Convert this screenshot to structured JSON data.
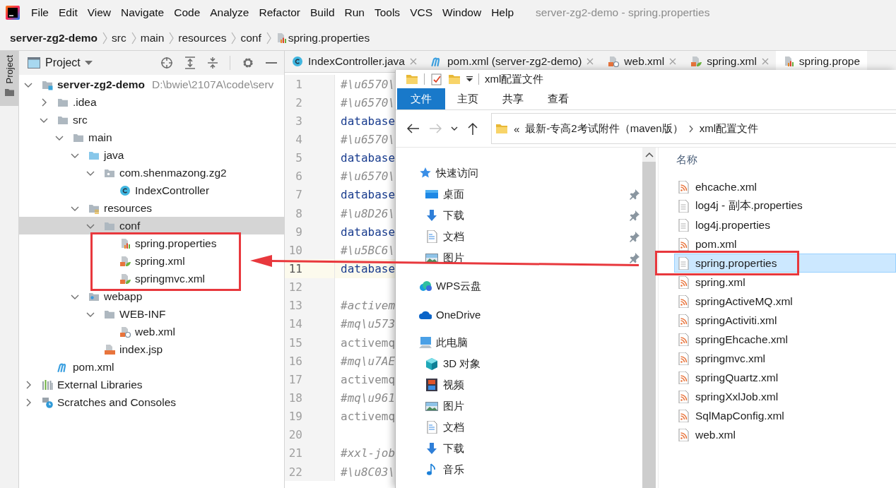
{
  "menu_bar": {
    "items": [
      "File",
      "Edit",
      "View",
      "Navigate",
      "Code",
      "Analyze",
      "Refactor",
      "Build",
      "Run",
      "Tools",
      "VCS",
      "Window",
      "Help"
    ],
    "window_title": "server-zg2-demo - spring.properties"
  },
  "breadcrumb": [
    {
      "label": "server-zg2-demo",
      "kind": "project"
    },
    {
      "label": "src",
      "kind": "folder"
    },
    {
      "label": "main",
      "kind": "folder"
    },
    {
      "label": "resources",
      "kind": "folder"
    },
    {
      "label": "conf",
      "kind": "folder"
    },
    {
      "label": "spring.properties",
      "kind": "properties"
    }
  ],
  "tool_stripe": {
    "label": "Project",
    "selected": true
  },
  "project_panel": {
    "title": "Project",
    "tree": [
      {
        "label": "server-zg2-demo",
        "kind": "module",
        "path": "D:\\bwie\\2107A\\code\\serv",
        "expanded": true,
        "selected": false,
        "children": [
          {
            "label": ".idea",
            "kind": "folder",
            "expanded": false,
            "selected": false
          },
          {
            "label": "src",
            "kind": "folder",
            "expanded": true,
            "selected": false,
            "children": [
              {
                "label": "main",
                "kind": "folder",
                "expanded": true,
                "selected": false,
                "children": [
                  {
                    "label": "java",
                    "kind": "source",
                    "expanded": true,
                    "selected": false,
                    "children": [
                      {
                        "label": "com.shenmazong.zg2",
                        "kind": "package",
                        "expanded": true,
                        "selected": false,
                        "children": [
                          {
                            "label": "IndexController",
                            "kind": "class",
                            "selected": false
                          }
                        ]
                      }
                    ]
                  },
                  {
                    "label": "resources",
                    "kind": "resources",
                    "expanded": true,
                    "selected": false,
                    "children": [
                      {
                        "label": "conf",
                        "kind": "folder",
                        "expanded": true,
                        "selected": true,
                        "children": [
                          {
                            "label": "spring.properties",
                            "kind": "properties",
                            "selected": false
                          },
                          {
                            "label": "spring.xml",
                            "kind": "spring-xml",
                            "selected": false
                          },
                          {
                            "label": "springmvc.xml",
                            "kind": "spring-xml",
                            "selected": false
                          }
                        ]
                      }
                    ]
                  },
                  {
                    "label": "webapp",
                    "kind": "webapp",
                    "expanded": true,
                    "selected": false,
                    "children": [
                      {
                        "label": "WEB-INF",
                        "kind": "folder",
                        "expanded": true,
                        "selected": false,
                        "children": [
                          {
                            "label": "web.xml",
                            "kind": "web-xml",
                            "selected": false
                          }
                        ]
                      },
                      {
                        "label": "index.jsp",
                        "kind": "jsp",
                        "selected": false
                      }
                    ]
                  }
                ]
              }
            ]
          },
          {
            "label": "pom.xml",
            "kind": "maven",
            "selected": false
          }
        ]
      },
      {
        "label": "External Libraries",
        "kind": "libraries",
        "expanded": false,
        "selected": false
      },
      {
        "label": "Scratches and Consoles",
        "kind": "scratches",
        "expanded": false,
        "selected": false
      }
    ]
  },
  "editor": {
    "tabs": [
      {
        "label": "IndexController.java",
        "kind": "class",
        "selected": false,
        "closable": true
      },
      {
        "label": "pom.xml (server-zg2-demo)",
        "kind": "maven",
        "selected": false,
        "closable": true
      },
      {
        "label": "web.xml",
        "kind": "web-xml",
        "selected": false,
        "closable": true
      },
      {
        "label": "spring.xml",
        "kind": "spring-xml",
        "selected": false,
        "closable": true
      },
      {
        "label": "spring.prope",
        "kind": "properties",
        "selected": true,
        "closable": false
      }
    ],
    "lines": [
      {
        "number": "1",
        "text": "#\\u6570\\",
        "kind": "comment",
        "current": false
      },
      {
        "number": "2",
        "text": "#\\u6570\\",
        "kind": "comment",
        "current": false
      },
      {
        "number": "3",
        "text": "database",
        "kind": "key",
        "current": false
      },
      {
        "number": "4",
        "text": "#\\u6570\\",
        "kind": "comment",
        "current": false
      },
      {
        "number": "5",
        "text": "database",
        "kind": "key",
        "current": false
      },
      {
        "number": "6",
        "text": "#\\u6570\\",
        "kind": "comment",
        "current": false
      },
      {
        "number": "7",
        "text": "database",
        "kind": "key",
        "current": false
      },
      {
        "number": "8",
        "text": "#\\u8D26\\",
        "kind": "comment",
        "current": false
      },
      {
        "number": "9",
        "text": "database",
        "kind": "key",
        "current": false
      },
      {
        "number": "10",
        "text": "#\\u5BC6\\",
        "kind": "comment",
        "current": false
      },
      {
        "number": "11",
        "text": "database",
        "kind": "key",
        "current": true
      },
      {
        "number": "12",
        "kind": "blank",
        "current": false
      },
      {
        "number": "13",
        "text": "#activem",
        "kind": "comment",
        "current": false
      },
      {
        "number": "14",
        "text": "#mq\\u573",
        "kind": "comment",
        "current": false
      },
      {
        "number": "15",
        "text": "activemq",
        "kind": "inactive",
        "current": false
      },
      {
        "number": "16",
        "text": "#mq\\u7AE",
        "kind": "comment",
        "current": false
      },
      {
        "number": "17",
        "text": "activemq",
        "kind": "inactive",
        "current": false
      },
      {
        "number": "18",
        "text": "#mq\\u961",
        "kind": "comment",
        "current": false
      },
      {
        "number": "19",
        "text": "activemq",
        "kind": "inactive",
        "current": false
      },
      {
        "number": "20",
        "kind": "blank",
        "current": false
      },
      {
        "number": "21",
        "text": "#xxl-job",
        "kind": "comment",
        "current": false
      },
      {
        "number": "22",
        "text": "#\\u8C03\\",
        "kind": "comment",
        "current": false
      }
    ]
  },
  "explorer": {
    "title": "xml配置文件",
    "ribbon_tabs": [
      {
        "label": "文件",
        "selected": true
      },
      {
        "label": "主页",
        "selected": false
      },
      {
        "label": "共享",
        "selected": false
      },
      {
        "label": "查看",
        "selected": false
      }
    ],
    "address": {
      "overflow_mark": "«",
      "segments": [
        "最新-专高2考试附件（maven版）",
        "xml配置文件"
      ]
    },
    "nav": [
      {
        "label": "快速访问",
        "kind": "star",
        "children": [
          {
            "label": "桌面",
            "kind": "desktop",
            "pinned": true
          },
          {
            "label": "下载",
            "kind": "download",
            "pinned": true
          },
          {
            "label": "文档",
            "kind": "document",
            "pinned": true
          },
          {
            "label": "图片",
            "kind": "picture",
            "pinned": true
          }
        ]
      },
      {
        "label": "WPS云盘",
        "kind": "wps-cloud"
      },
      {
        "label": "OneDrive",
        "kind": "onedrive"
      },
      {
        "label": "此电脑",
        "kind": "computer",
        "children": [
          {
            "label": "3D 对象",
            "kind": "cube",
            "pinned": false
          },
          {
            "label": "视频",
            "kind": "video",
            "pinned": false
          },
          {
            "label": "图片",
            "kind": "picture",
            "pinned": false
          },
          {
            "label": "文档",
            "kind": "document",
            "pinned": false
          },
          {
            "label": "下载",
            "kind": "download",
            "pinned": false
          },
          {
            "label": "音乐",
            "kind": "music",
            "pinned": false
          }
        ]
      }
    ],
    "column_header": "名称",
    "files": [
      {
        "name": "ehcache.xml",
        "kind": "xml",
        "selected": false
      },
      {
        "name": "log4j - 副本.properties",
        "kind": "text",
        "selected": false
      },
      {
        "name": "log4j.properties",
        "kind": "text",
        "selected": false
      },
      {
        "name": "pom.xml",
        "kind": "xml",
        "selected": false
      },
      {
        "name": "spring.properties",
        "kind": "text",
        "selected": true
      },
      {
        "name": "spring.xml",
        "kind": "xml",
        "selected": false
      },
      {
        "name": "springActiveMQ.xml",
        "kind": "xml",
        "selected": false
      },
      {
        "name": "springActiviti.xml",
        "kind": "xml",
        "selected": false
      },
      {
        "name": "springEhcache.xml",
        "kind": "xml",
        "selected": false
      },
      {
        "name": "springmvc.xml",
        "kind": "xml",
        "selected": false
      },
      {
        "name": "springQuartz.xml",
        "kind": "xml",
        "selected": false
      },
      {
        "name": "springXxlJob.xml",
        "kind": "xml",
        "selected": false
      },
      {
        "name": "SqlMapConfig.xml",
        "kind": "xml",
        "selected": false
      },
      {
        "name": "web.xml",
        "kind": "xml",
        "selected": false
      }
    ]
  }
}
